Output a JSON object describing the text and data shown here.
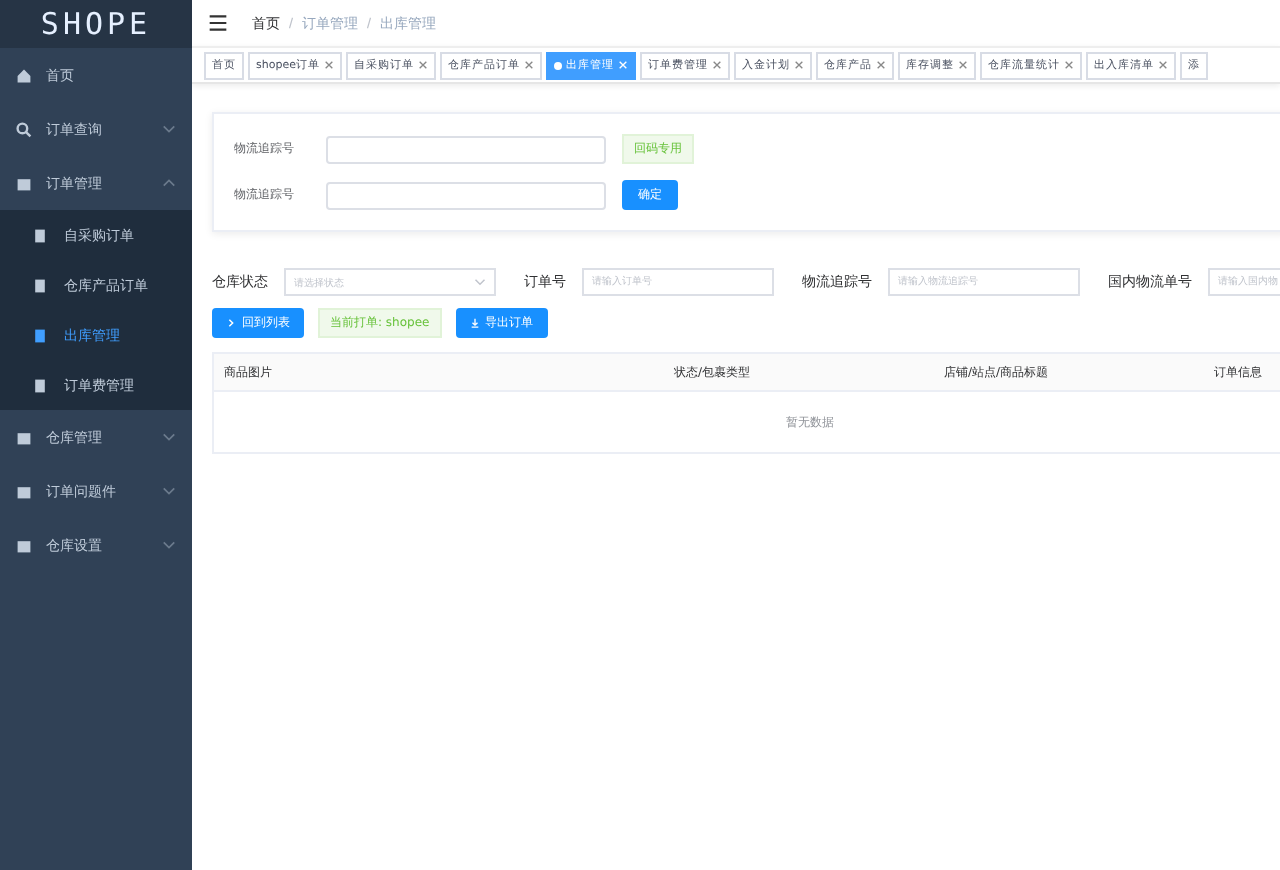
{
  "logo": "SHOPE",
  "sidebar": {
    "items": [
      {
        "label": "首页"
      },
      {
        "label": "订单查询",
        "expanded": false
      },
      {
        "label": "订单管理",
        "expanded": true,
        "children": [
          {
            "label": "自采购订单",
            "selected": false
          },
          {
            "label": "仓库产品订单",
            "selected": false
          },
          {
            "label": "出库管理",
            "selected": true
          },
          {
            "label": "订单费管理",
            "selected": false
          }
        ]
      },
      {
        "label": "仓库管理",
        "expanded": false
      },
      {
        "label": "订单问题件",
        "expanded": false
      },
      {
        "label": "仓库设置",
        "expanded": false
      }
    ]
  },
  "breadcrumb": [
    "首页",
    "订单管理",
    "出库管理"
  ],
  "tabs": [
    {
      "label": "首页",
      "selected": false,
      "closable": false
    },
    {
      "label": "shopee订单",
      "selected": false,
      "closable": true
    },
    {
      "label": "自采购订单",
      "selected": false,
      "closable": true
    },
    {
      "label": "仓库产品订单",
      "selected": false,
      "closable": true
    },
    {
      "label": "出库管理",
      "selected": true,
      "closable": true
    },
    {
      "label": "订单费管理",
      "selected": false,
      "closable": true
    },
    {
      "label": "入金计划",
      "selected": false,
      "closable": true
    },
    {
      "label": "仓库产品",
      "selected": false,
      "closable": true
    },
    {
      "label": "库存调整",
      "selected": false,
      "closable": true
    },
    {
      "label": "仓库流量统计",
      "selected": false,
      "closable": true
    },
    {
      "label": "出入库清单",
      "selected": false,
      "closable": true
    },
    {
      "label": "添",
      "selected": false,
      "closable": false
    }
  ],
  "scan_form": [
    {
      "label": "物流追踪号",
      "kind": "tag",
      "action": "回码专用"
    },
    {
      "label": "物流追踪号",
      "kind": "button",
      "action": "确定"
    }
  ],
  "filters": [
    {
      "label": "仓库状态",
      "kind": "select",
      "placeholder": "请选择状态"
    },
    {
      "label": "订单号",
      "kind": "input",
      "placeholder": "请输入订单号"
    },
    {
      "label": "物流追踪号",
      "kind": "input",
      "placeholder": "请输入物流追踪号"
    },
    {
      "label": "国内物流单号",
      "kind": "input",
      "placeholder": "请输入国内物"
    }
  ],
  "actions": [
    {
      "kind": "button",
      "label": "回到列表"
    },
    {
      "kind": "tag",
      "label": "当前打单: shopee"
    },
    {
      "kind": "button",
      "label": "导出订单"
    }
  ],
  "table": {
    "columns": [
      "商品图片",
      "状态/包裹类型",
      "店铺/站点/商品标题",
      "订单信息"
    ],
    "empty_text": "暂无数据"
  }
}
